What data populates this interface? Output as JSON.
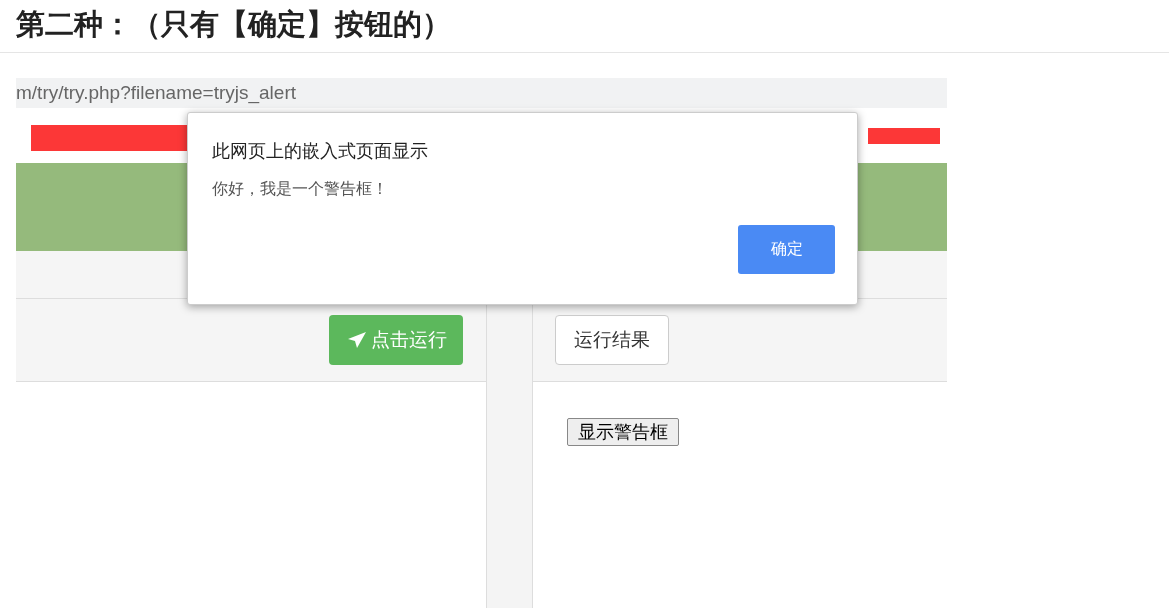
{
  "heading": "第二种：（只有【确定】按钮的）",
  "screenshot": {
    "address_bar": "m/try/try.php?filename=tryjs_alert",
    "run_button": "点击运行",
    "result_tab": "运行结果",
    "result_button": "显示警告框",
    "dialog": {
      "title": "此网页上的嵌入式页面显示",
      "message": "你好，我是一个警告框！",
      "ok_button": "确定"
    }
  }
}
